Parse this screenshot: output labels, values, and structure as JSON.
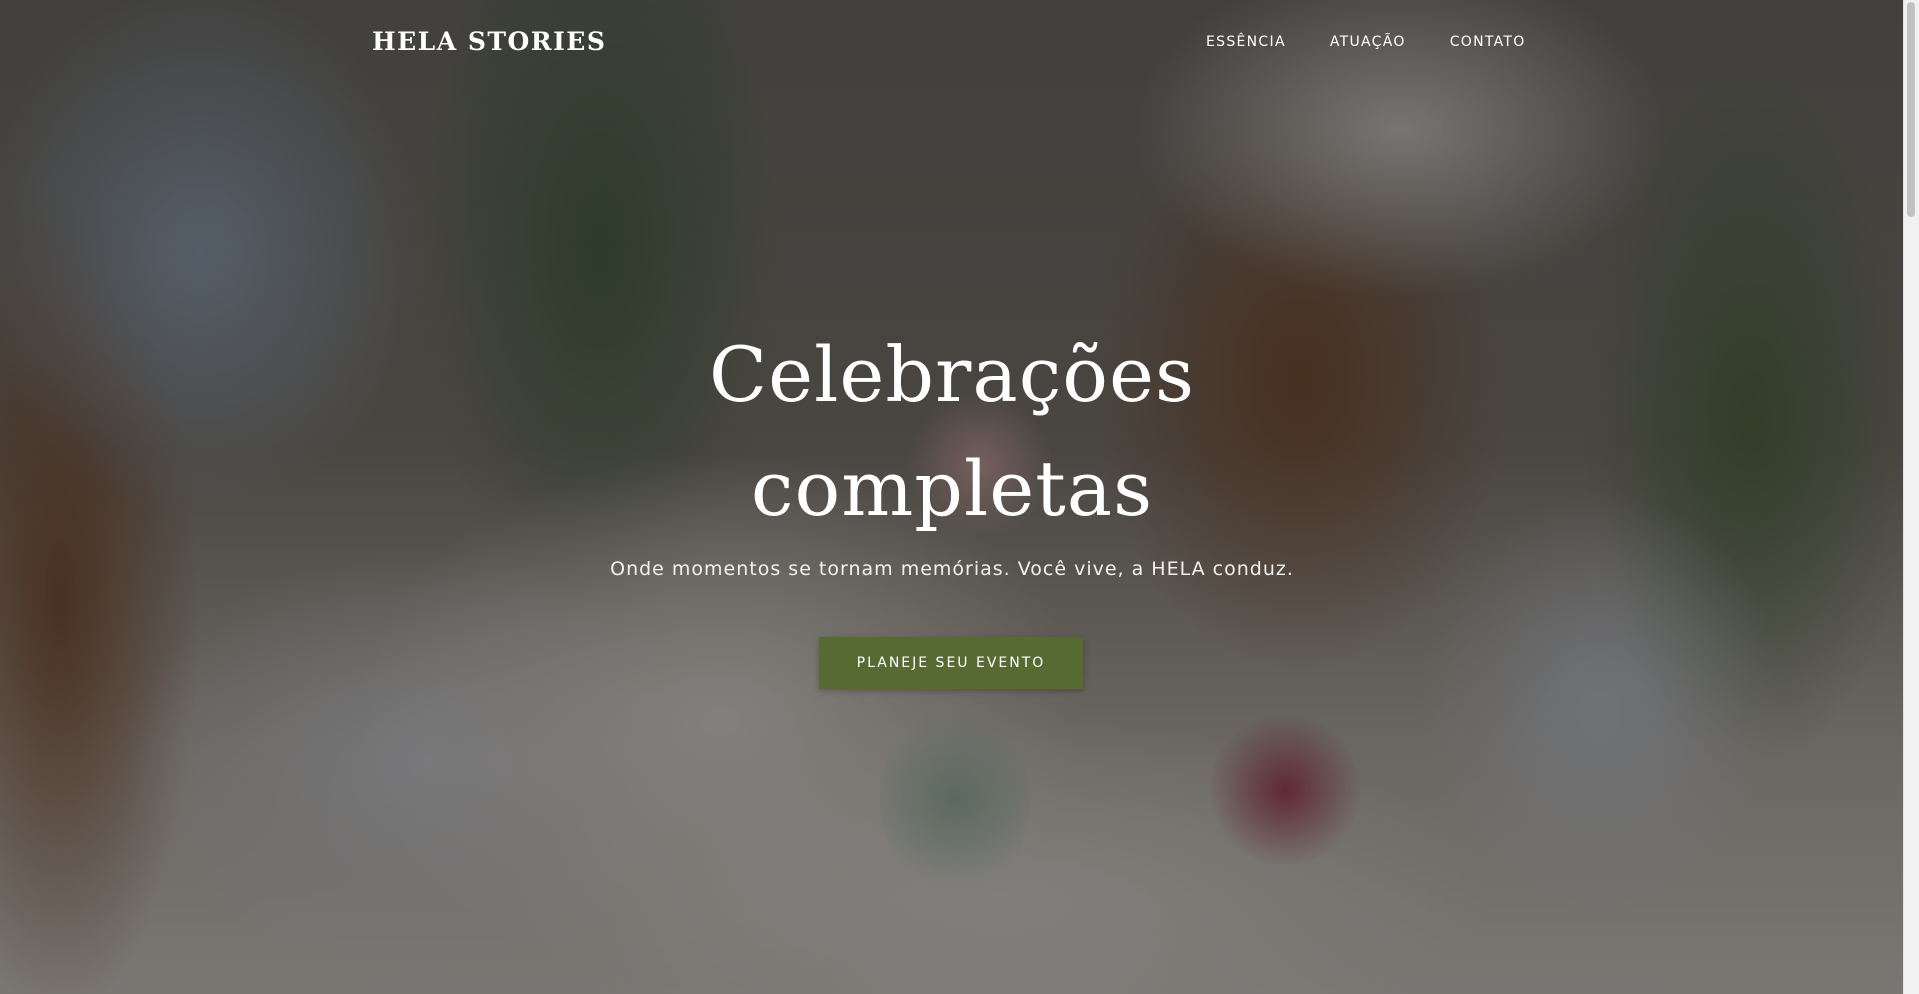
{
  "brand": {
    "name": "HELA STORIES"
  },
  "nav": {
    "items": [
      {
        "label": "ESSÊNCIA"
      },
      {
        "label": "ATUAÇÃO"
      },
      {
        "label": "CONTATO"
      }
    ]
  },
  "hero": {
    "title_line1": "Celebrações",
    "title_line2": "completas",
    "subtitle": "Onde momentos se tornam memórias. Você vive, a HELA conduz.",
    "cta_label": "PLANEJE SEU EVENTO",
    "background_description_icon": "hero-background-image",
    "colors": {
      "cta_background": "#556b32",
      "text": "#ffffff"
    }
  }
}
